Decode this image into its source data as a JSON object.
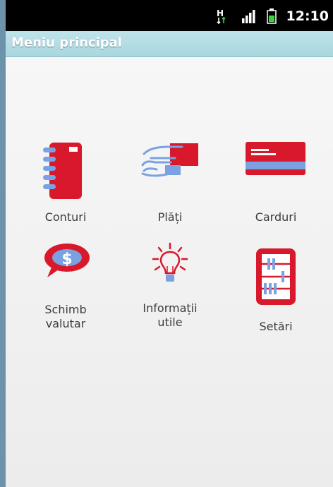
{
  "status_bar": {
    "time": "12:10",
    "icons": [
      "network-hplus-icon",
      "signal-strength-icon",
      "battery-icon"
    ]
  },
  "header": {
    "title": "Meniu principal"
  },
  "menu": {
    "items": [
      {
        "label": "Conturi",
        "icon": "notebook-icon"
      },
      {
        "label": "Plăți",
        "icon": "hand-card-icon"
      },
      {
        "label": "Carduri",
        "icon": "card-icon"
      },
      {
        "label_line1": "Schimb",
        "label_line2": "valutar",
        "icon": "dollar-speech-icon"
      },
      {
        "label_line1": "Informații",
        "label_line2": "utile",
        "icon": "lightbulb-icon"
      },
      {
        "label": "Setări",
        "icon": "abacus-icon"
      }
    ]
  },
  "colors": {
    "accent_red": "#d8192c",
    "accent_blue": "#7aa2e2",
    "title_bar": "#a9d6df"
  }
}
